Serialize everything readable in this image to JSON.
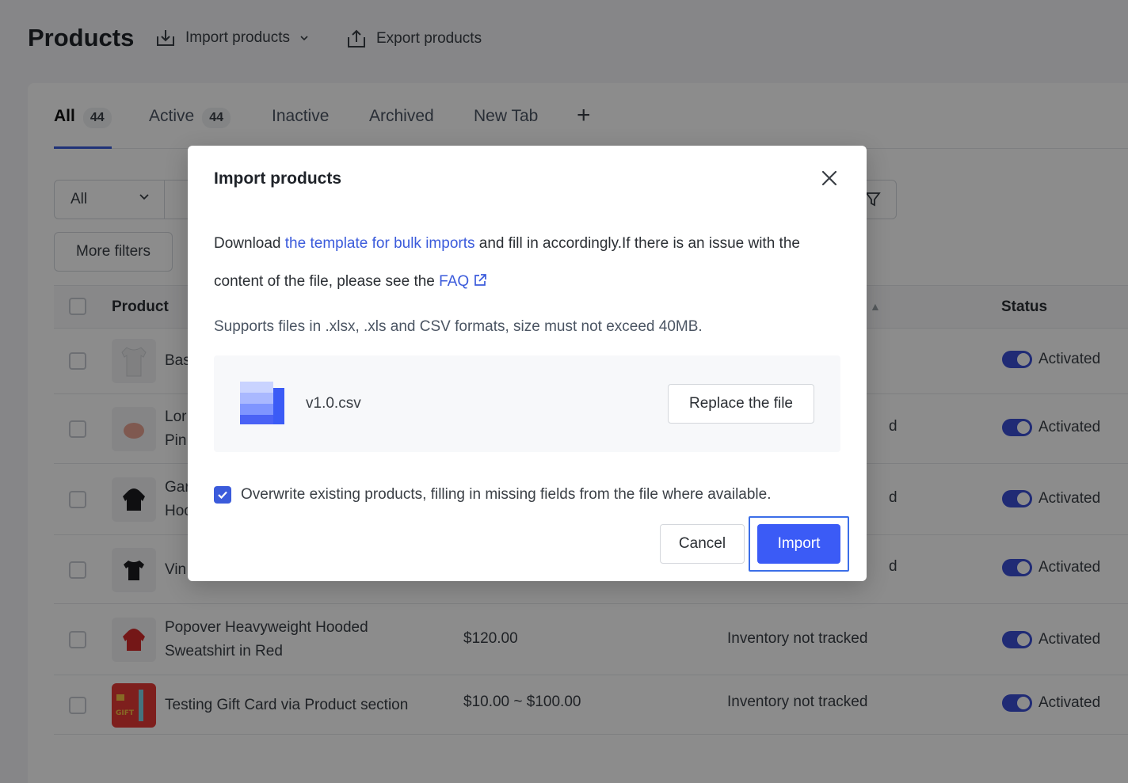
{
  "header": {
    "title": "Products",
    "import_label": "Import products",
    "export_label": "Export products"
  },
  "tabs": [
    {
      "label": "All",
      "count": "44"
    },
    {
      "label": "Active",
      "count": "44"
    },
    {
      "label": "Inactive"
    },
    {
      "label": "Archived"
    },
    {
      "label": "New Tab"
    }
  ],
  "filters": {
    "select_value": "All",
    "more_filters_label": "More filters"
  },
  "table": {
    "headers": {
      "product": "Product",
      "status": "Status"
    },
    "rows": [
      {
        "name": "Bas",
        "price": "",
        "inventory": "",
        "status": "Activated"
      },
      {
        "name": "Lor\nPin",
        "price": "",
        "inventory": "d",
        "status": "Activated"
      },
      {
        "name": "Gar\nHoo",
        "price": "",
        "inventory": "d",
        "status": "Activated"
      },
      {
        "name": "Vin",
        "price": "",
        "inventory": "d",
        "status": "Activated"
      },
      {
        "name": "Popover Heavyweight Hooded\nSweatshirt in Red",
        "price": "$120.00",
        "inventory": "Inventory not tracked",
        "status": "Activated"
      },
      {
        "name": "Testing Gift Card via Product section",
        "price": "$10.00 ~ $100.00",
        "inventory": "Inventory not tracked",
        "status": "Activated",
        "gift_label": "GIFT"
      }
    ]
  },
  "modal": {
    "title": "Import products",
    "text_download": "Download ",
    "template_link": "the template for bulk imports",
    "text_after_link": " and fill in accordingly.If there is an issue with the content of the file, please see the ",
    "faq_link": "FAQ",
    "supports": "Supports files in .xlsx, .xls and CSV formats, size must not exceed 40MB.",
    "file_name": "v1.0.csv",
    "replace_label": "Replace the file",
    "overwrite_label": "Overwrite existing products, filling in missing fields from the file where available.",
    "overwrite_checked": true,
    "cancel_label": "Cancel",
    "import_label": "Import"
  },
  "colors": {
    "accent": "#3b5bf6",
    "toggle_on": "#3b4fd6"
  }
}
